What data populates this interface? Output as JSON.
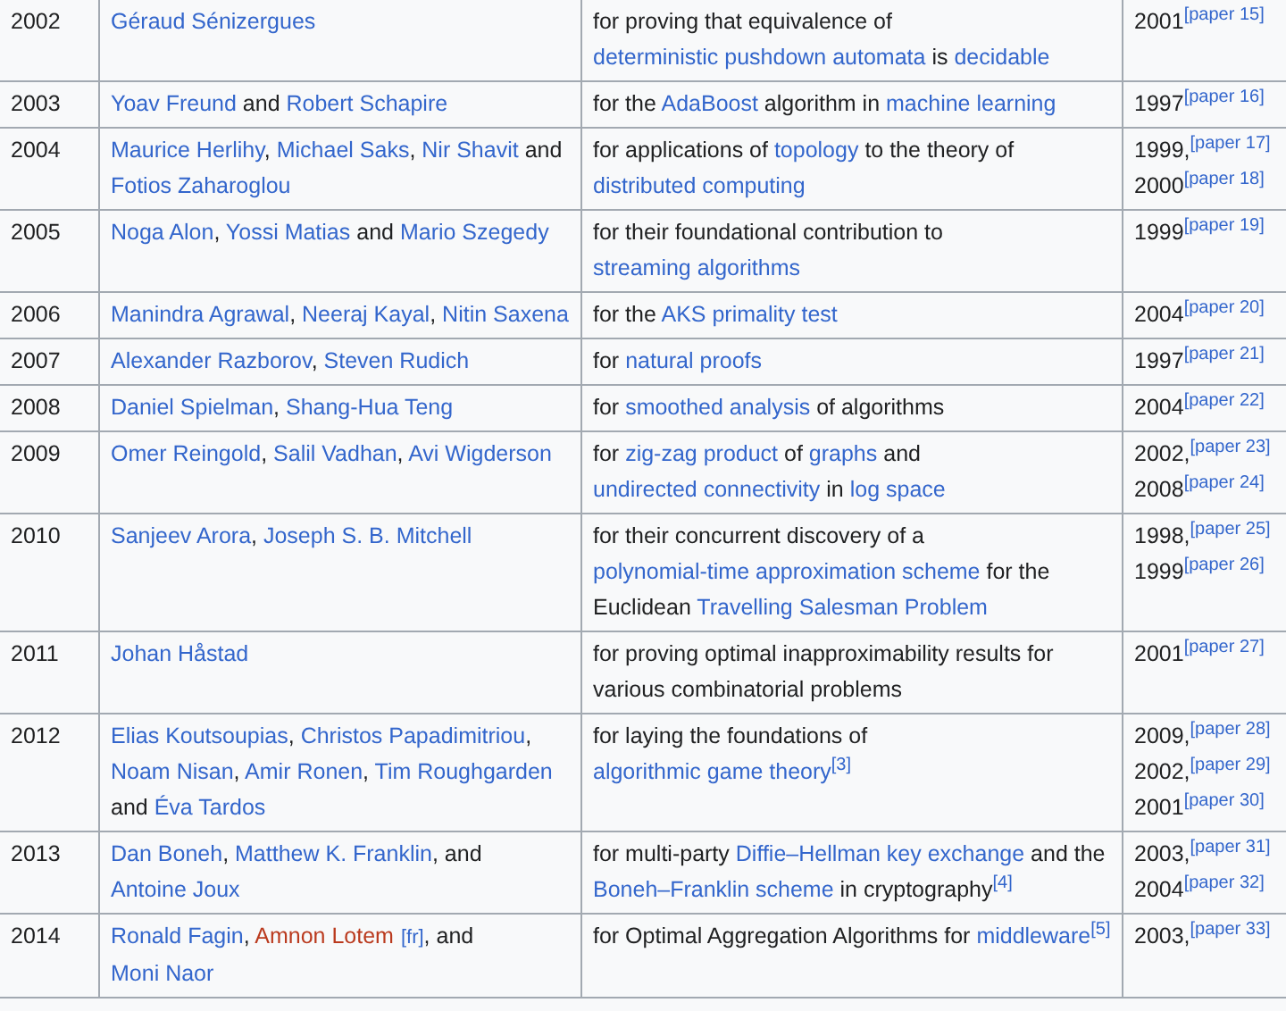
{
  "table": {
    "rows": [
      {
        "year": "2002",
        "recipients": [
          {
            "kind": "link",
            "text": "Géraud Sénizergues"
          }
        ],
        "rationale": [
          {
            "kind": "plain",
            "text": "for proving that equivalence of "
          },
          {
            "kind": "link",
            "text": "deterministic pushdown automata"
          },
          {
            "kind": "plain",
            "text": " is "
          },
          {
            "kind": "link",
            "text": "decidable"
          }
        ],
        "papers": [
          {
            "year": "2001",
            "ref": "[paper 15]"
          }
        ]
      },
      {
        "year": "2003",
        "recipients": [
          {
            "kind": "link",
            "text": "Yoav Freund"
          },
          {
            "kind": "plain",
            "text": " and "
          },
          {
            "kind": "link",
            "text": "Robert Schapire"
          }
        ],
        "rationale": [
          {
            "kind": "plain",
            "text": "for the "
          },
          {
            "kind": "link",
            "text": "AdaBoost"
          },
          {
            "kind": "plain",
            "text": " algorithm in "
          },
          {
            "kind": "link",
            "text": "machine learning"
          }
        ],
        "papers": [
          {
            "year": "1997",
            "ref": "[paper 16]"
          }
        ]
      },
      {
        "year": "2004",
        "recipients": [
          {
            "kind": "link",
            "text": "Maurice Herlihy"
          },
          {
            "kind": "plain",
            "text": ", "
          },
          {
            "kind": "link",
            "text": "Michael Saks"
          },
          {
            "kind": "plain",
            "text": ", "
          },
          {
            "kind": "link",
            "text": "Nir Shavit"
          },
          {
            "kind": "plain",
            "text": " and "
          },
          {
            "kind": "link",
            "text": "Fotios Zaharoglou"
          }
        ],
        "rationale": [
          {
            "kind": "plain",
            "text": "for applications of "
          },
          {
            "kind": "link",
            "text": "topology"
          },
          {
            "kind": "plain",
            "text": " to the theory of "
          },
          {
            "kind": "link",
            "text": "distributed computing"
          }
        ],
        "papers": [
          {
            "year": "1999,",
            "ref": "[paper 17]"
          },
          {
            "year": "2000",
            "ref": "[paper 18]"
          }
        ]
      },
      {
        "year": "2005",
        "recipients": [
          {
            "kind": "link",
            "text": "Noga Alon"
          },
          {
            "kind": "plain",
            "text": ", "
          },
          {
            "kind": "link",
            "text": "Yossi Matias"
          },
          {
            "kind": "plain",
            "text": " and "
          },
          {
            "kind": "link",
            "text": "Mario Szegedy"
          }
        ],
        "rationale": [
          {
            "kind": "plain",
            "text": "for their foundational contribution to "
          },
          {
            "kind": "link",
            "text": "streaming algorithms"
          }
        ],
        "papers": [
          {
            "year": "1999",
            "ref": "[paper 19]"
          }
        ]
      },
      {
        "year": "2006",
        "recipients": [
          {
            "kind": "link",
            "text": "Manindra Agrawal"
          },
          {
            "kind": "plain",
            "text": ", "
          },
          {
            "kind": "link",
            "text": "Neeraj Kayal"
          },
          {
            "kind": "plain",
            "text": ", "
          },
          {
            "kind": "link",
            "text": "Nitin Saxena"
          }
        ],
        "rationale": [
          {
            "kind": "plain",
            "text": "for the "
          },
          {
            "kind": "link",
            "text": "AKS primality test"
          }
        ],
        "papers": [
          {
            "year": "2004",
            "ref": "[paper 20]"
          }
        ]
      },
      {
        "year": "2007",
        "recipients": [
          {
            "kind": "link",
            "text": "Alexander Razborov"
          },
          {
            "kind": "plain",
            "text": ", "
          },
          {
            "kind": "link",
            "text": "Steven Rudich"
          }
        ],
        "rationale": [
          {
            "kind": "plain",
            "text": "for "
          },
          {
            "kind": "link",
            "text": "natural proofs"
          }
        ],
        "papers": [
          {
            "year": "1997",
            "ref": "[paper 21]"
          }
        ]
      },
      {
        "year": "2008",
        "recipients": [
          {
            "kind": "link",
            "text": "Daniel Spielman"
          },
          {
            "kind": "plain",
            "text": ", "
          },
          {
            "kind": "link",
            "text": "Shang-Hua Teng"
          }
        ],
        "rationale": [
          {
            "kind": "plain",
            "text": "for "
          },
          {
            "kind": "link",
            "text": "smoothed analysis"
          },
          {
            "kind": "plain",
            "text": " of algorithms"
          }
        ],
        "papers": [
          {
            "year": "2004",
            "ref": "[paper 22]"
          }
        ]
      },
      {
        "year": "2009",
        "recipients": [
          {
            "kind": "link",
            "text": "Omer Reingold"
          },
          {
            "kind": "plain",
            "text": ", "
          },
          {
            "kind": "link",
            "text": "Salil Vadhan"
          },
          {
            "kind": "plain",
            "text": ", "
          },
          {
            "kind": "link",
            "text": "Avi Wigderson"
          }
        ],
        "rationale": [
          {
            "kind": "plain",
            "text": "for "
          },
          {
            "kind": "link",
            "text": "zig-zag product"
          },
          {
            "kind": "plain",
            "text": " of "
          },
          {
            "kind": "link",
            "text": "graphs"
          },
          {
            "kind": "plain",
            "text": " and "
          },
          {
            "kind": "link",
            "text": "undirected connectivity"
          },
          {
            "kind": "plain",
            "text": " in "
          },
          {
            "kind": "link",
            "text": "log space"
          }
        ],
        "papers": [
          {
            "year": "2002,",
            "ref": "[paper 23]"
          },
          {
            "year": "2008",
            "ref": "[paper 24]"
          }
        ]
      },
      {
        "year": "2010",
        "recipients": [
          {
            "kind": "link",
            "text": "Sanjeev Arora"
          },
          {
            "kind": "plain",
            "text": ", "
          },
          {
            "kind": "link",
            "text": "Joseph S. B. Mitchell"
          }
        ],
        "rationale": [
          {
            "kind": "plain",
            "text": "for their concurrent discovery of a "
          },
          {
            "kind": "link",
            "text": "polynomial-time approximation scheme"
          },
          {
            "kind": "plain",
            "text": " for the Euclidean "
          },
          {
            "kind": "link",
            "text": "Travelling Salesman Problem"
          }
        ],
        "papers": [
          {
            "year": "1998,",
            "ref": "[paper 25]"
          },
          {
            "year": "1999",
            "ref": "[paper 26]"
          }
        ]
      },
      {
        "year": "2011",
        "recipients": [
          {
            "kind": "link",
            "text": "Johan Håstad"
          }
        ],
        "rationale": [
          {
            "kind": "plain",
            "text": "for proving optimal inapproximability results for various combinatorial problems"
          }
        ],
        "papers": [
          {
            "year": "2001",
            "ref": "[paper 27]"
          }
        ]
      },
      {
        "year": "2012",
        "recipients": [
          {
            "kind": "link",
            "text": "Elias Koutsoupias"
          },
          {
            "kind": "plain",
            "text": ", "
          },
          {
            "kind": "link",
            "text": "Christos Papadimitriou"
          },
          {
            "kind": "plain",
            "text": ", "
          },
          {
            "kind": "link",
            "text": "Noam Nisan"
          },
          {
            "kind": "plain",
            "text": ", "
          },
          {
            "kind": "link",
            "text": "Amir Ronen"
          },
          {
            "kind": "plain",
            "text": ", "
          },
          {
            "kind": "link",
            "text": "Tim Roughgarden"
          },
          {
            "kind": "plain",
            "text": " and "
          },
          {
            "kind": "link",
            "text": "Éva Tardos"
          }
        ],
        "rationale": [
          {
            "kind": "plain",
            "text": "for laying the foundations of "
          },
          {
            "kind": "link",
            "text": "algorithmic game theory"
          },
          {
            "kind": "ref",
            "text": "[3]"
          }
        ],
        "papers": [
          {
            "year": "2009,",
            "ref": "[paper 28]"
          },
          {
            "year": "2002,",
            "ref": "[paper 29]"
          },
          {
            "year": "2001",
            "ref": "[paper 30]"
          }
        ]
      },
      {
        "year": "2013",
        "recipients": [
          {
            "kind": "link",
            "text": "Dan Boneh"
          },
          {
            "kind": "plain",
            "text": ", "
          },
          {
            "kind": "link",
            "text": "Matthew K. Franklin"
          },
          {
            "kind": "plain",
            "text": ", and "
          },
          {
            "kind": "link",
            "text": "Antoine Joux"
          }
        ],
        "rationale": [
          {
            "kind": "plain",
            "text": "for multi-party "
          },
          {
            "kind": "link",
            "text": "Diffie–Hellman key exchange"
          },
          {
            "kind": "plain",
            "text": " and the "
          },
          {
            "kind": "link",
            "text": "Boneh–Franklin scheme"
          },
          {
            "kind": "plain",
            "text": " in cryptography"
          },
          {
            "kind": "ref",
            "text": "[4]"
          }
        ],
        "papers": [
          {
            "year": "2003,",
            "ref": "[paper 31]"
          },
          {
            "year": "2004",
            "ref": "[paper 32]"
          }
        ]
      },
      {
        "year": "2014",
        "recipients": [
          {
            "kind": "link",
            "text": "Ronald Fagin"
          },
          {
            "kind": "plain",
            "text": ", "
          },
          {
            "kind": "redlink",
            "text": "Amnon Lotem"
          },
          {
            "kind": "interlang",
            "text": "[fr]"
          },
          {
            "kind": "plain",
            "text": ", and "
          },
          {
            "kind": "link",
            "text": "Moni Naor"
          }
        ],
        "rationale": [
          {
            "kind": "plain",
            "text": "for Optimal Aggregation Algorithms for "
          },
          {
            "kind": "link",
            "text": "middleware"
          },
          {
            "kind": "ref",
            "text": "[5]"
          }
        ],
        "papers": [
          {
            "year": "2003,",
            "ref": "[paper 33]"
          }
        ]
      }
    ]
  }
}
